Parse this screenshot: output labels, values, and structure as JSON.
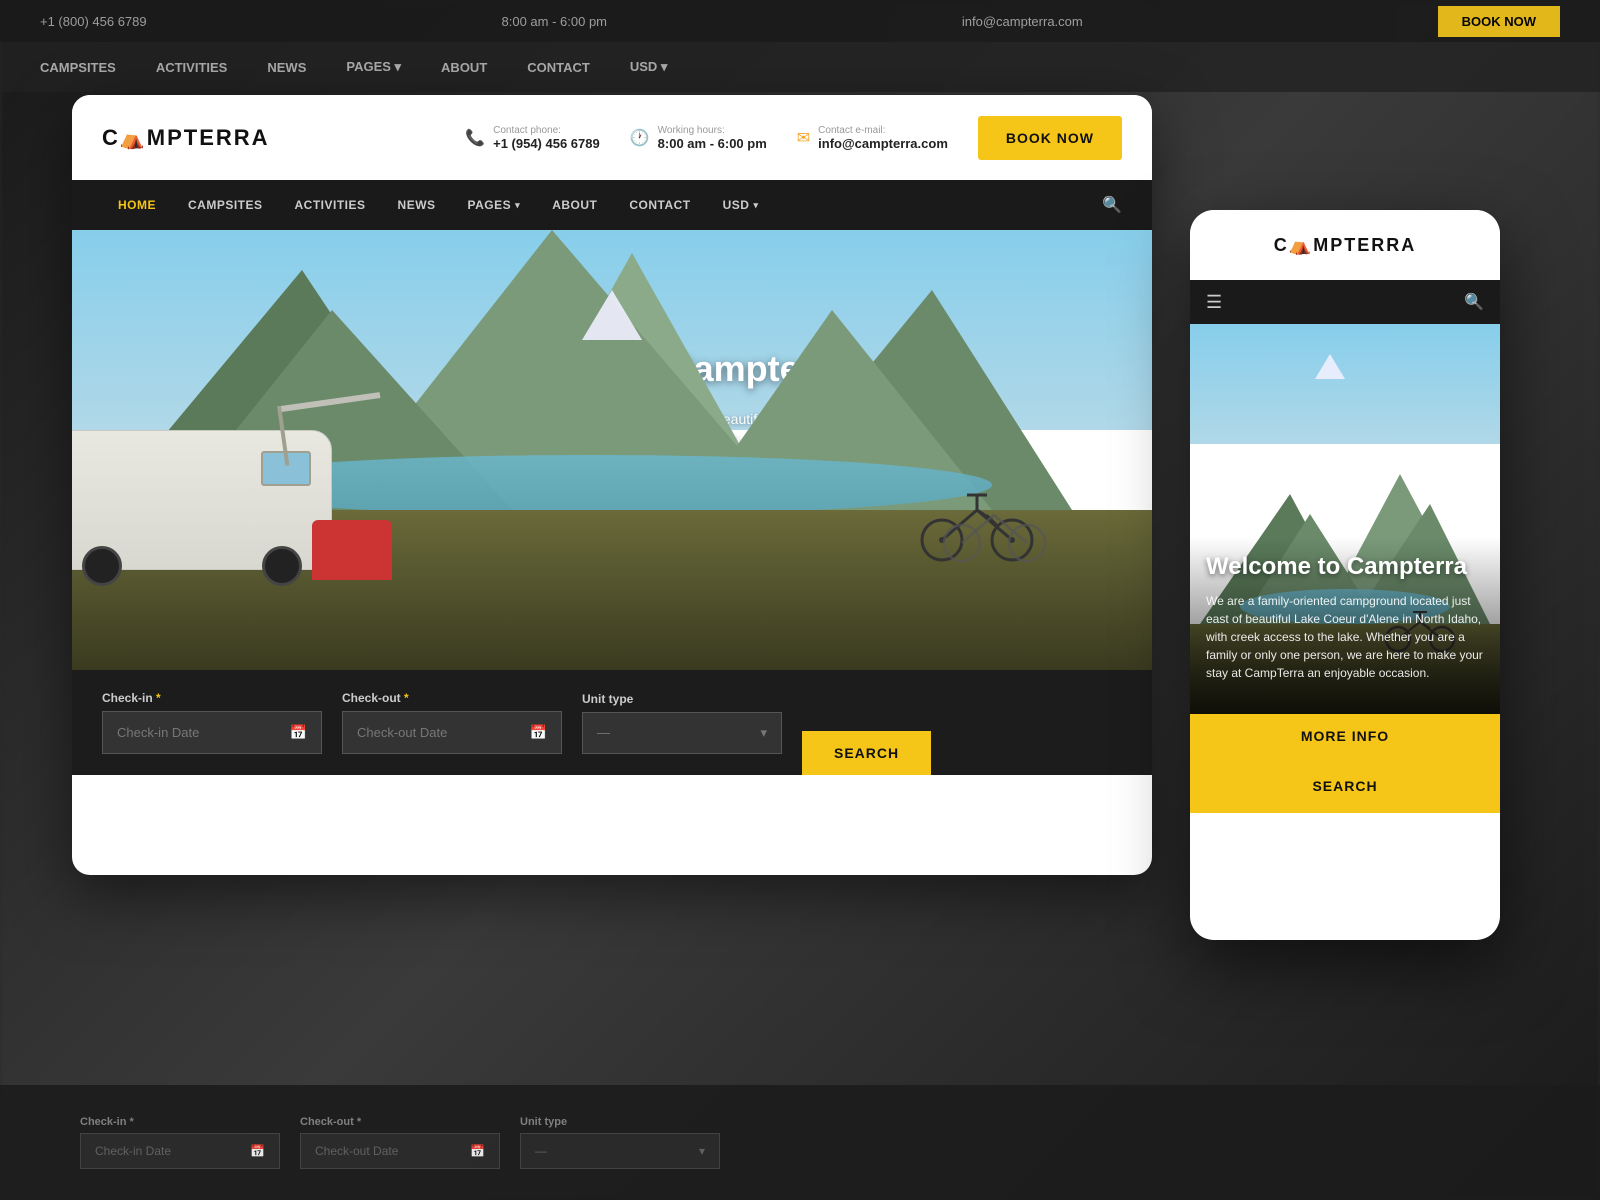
{
  "site": {
    "brand": "C",
    "brand_a": "Â",
    "brand_rest": "MPTERRA",
    "logo_full": "CÂMPTERRA"
  },
  "header": {
    "contact_phone_label": "Contact phone:",
    "contact_phone": "+1 (954) 456 6789",
    "working_hours_label": "Working hours:",
    "working_hours": "8:00 am - 6:00 pm",
    "contact_email_label": "Contact e-mail:",
    "contact_email": "info@campterra.com",
    "book_now_label": "BOOK NOW"
  },
  "nav": {
    "home": "HOME",
    "campsites": "CAMPSITES",
    "activities": "ACTIVITIES",
    "news": "NEWS",
    "pages": "PAGES",
    "about": "ABOUT",
    "contact": "CONTACT",
    "usd": "USD"
  },
  "hero": {
    "title": "Welcome to Campterra",
    "description": "We are a family-oriented campground located just east of beautiful Lake Coeur d'Alene in North Idaho, with creek access to the lake. Whether you are a family or only one person, we are here to make your stay at CampTerra an enjoyable occasion.",
    "more_info_label": "MORE INFO"
  },
  "booking": {
    "checkin_label": "Check-in",
    "checkin_required": "*",
    "checkin_placeholder": "Check-in Date",
    "checkout_label": "Check-out",
    "checkout_required": "*",
    "checkout_placeholder": "Check-out Date",
    "unit_type_label": "Unit type",
    "unit_type_placeholder": "—",
    "search_label": "SEARCH"
  },
  "mobile": {
    "logo": "CÂMPTERRA",
    "hero_title": "Welcome to Campterra",
    "hero_description": "We are a family-oriented campground located just east of beautiful Lake Coeur d'Alene in North Idaho, with creek access to the lake. Whether you are a family or only one person, we are here to make your stay at CampTerra an enjoyable occasion.",
    "more_info_label": "MORE INFO"
  },
  "bg_nav": {
    "items": [
      "CAMPSITES",
      "ACTIVITIES",
      "NEWS",
      "PAGES ▾",
      "ABOUT",
      "CONTACT",
      "USD ▾"
    ]
  },
  "top_bar_bg": {
    "phone": "+1 (800) 456 6789",
    "hours": "8:00 am - 6:00 pm",
    "email": "info@campterra.com",
    "book_label": "BOOK NOW"
  }
}
